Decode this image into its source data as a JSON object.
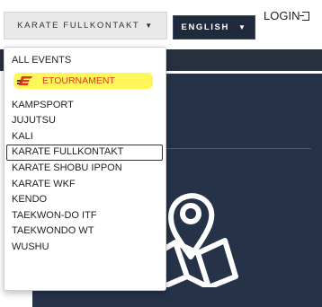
{
  "header": {
    "sport_select_label": "KARATE FULLKONTAKT",
    "language_select_label": "ENGLISH",
    "login_label": "LOGIN",
    "caret": "▼"
  },
  "dropdown": {
    "options_top": [
      "ALL EVENTS"
    ],
    "highlight_option": "ETOURNAMENT",
    "options": [
      "KAMPSPORT",
      "JUJUTSU",
      "KALI",
      "KARATE FULLKONTAKT",
      "KARATE SHOBU IPPON",
      "KARATE WKF",
      "KENDO",
      "TAEKWON-DO ITF",
      "TAEKWONDO WT",
      "WUSHU"
    ],
    "selected_option": "KARATE FULLKONTAKT"
  },
  "colors": {
    "hero_background": "#253248",
    "highlight": "#fff75a",
    "brand_red": "#e8321e"
  },
  "icons": {
    "hero_icon": "map-pin-icon",
    "login_icon": "sign-in-icon",
    "etournament_logo": "etournament-logo"
  }
}
